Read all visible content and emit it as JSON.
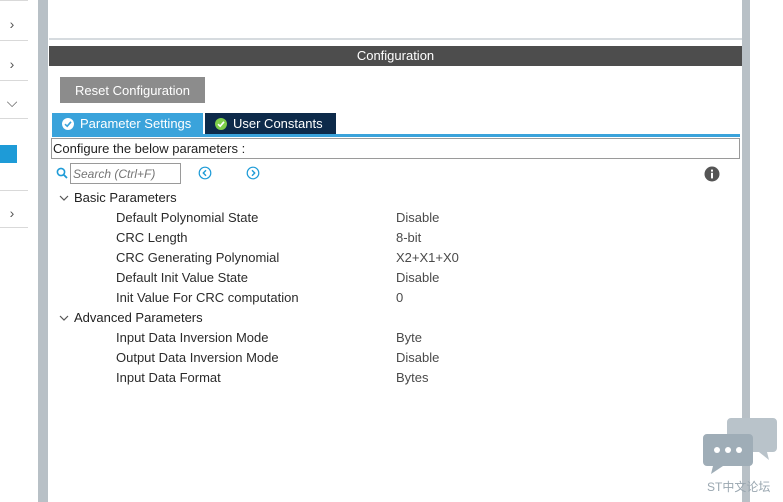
{
  "config": {
    "header_title": "Configuration",
    "reset_label": "Reset Configuration",
    "tabs": [
      {
        "label": "Parameter Settings",
        "active": true
      },
      {
        "label": "User Constants",
        "active": false
      }
    ],
    "description": "Configure the below parameters :",
    "search_placeholder": "Search (Ctrl+F)"
  },
  "groups": [
    {
      "label": "Basic Parameters",
      "expanded": true,
      "params": [
        {
          "name": "Default Polynomial State",
          "value": "Disable"
        },
        {
          "name": "CRC Length",
          "value": "8-bit"
        },
        {
          "name": "CRC Generating Polynomial",
          "value": "X2+X1+X0"
        },
        {
          "name": "Default Init Value State",
          "value": "Disable"
        },
        {
          "name": "Init Value For CRC computation",
          "value": "0"
        }
      ]
    },
    {
      "label": "Advanced Parameters",
      "expanded": true,
      "params": [
        {
          "name": "Input Data Inversion Mode",
          "value": "Byte"
        },
        {
          "name": "Output Data Inversion Mode",
          "value": "Disable"
        },
        {
          "name": "Input Data Format",
          "value": "Bytes"
        }
      ]
    }
  ],
  "watermark": {
    "text": "ST中文论坛"
  },
  "colors": {
    "header_bg": "#4d4d4d",
    "active_tab": "#3aa3db",
    "inactive_tab": "#0d2a4a",
    "reset_button": "#8c8c8c"
  },
  "icons": {
    "left_chevrons": [
      "chevron-right-icon",
      "chevron-right-icon",
      "chevron-down-icon",
      "chevron-right-icon"
    ],
    "search": "search-icon",
    "prev": "arrow-left-circle-icon",
    "next": "arrow-right-circle-icon",
    "info": "info-icon",
    "tab_check": "check-circle-icon"
  }
}
